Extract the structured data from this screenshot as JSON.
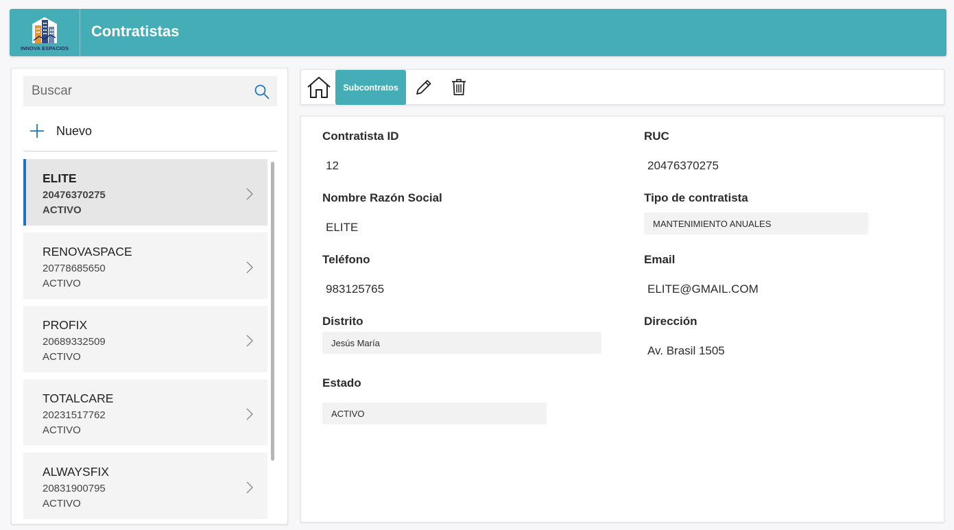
{
  "header": {
    "logo_text": "INNOVA ESPACIOS",
    "title": "Contratistas",
    "color": "#45adb6"
  },
  "search": {
    "placeholder": "Buscar"
  },
  "new_button": {
    "label": "Nuevo"
  },
  "list": [
    {
      "name": "ELITE",
      "ruc": "20476370275",
      "state": "ACTIVO",
      "selected": true
    },
    {
      "name": "RENOVASPACE",
      "ruc": "20778685650",
      "state": "ACTIVO"
    },
    {
      "name": "PROFIX",
      "ruc": "20689332509",
      "state": "ACTIVO"
    },
    {
      "name": "TOTALCARE",
      "ruc": "20231517762",
      "state": "ACTIVO"
    },
    {
      "name": "ALWAYSFIX",
      "ruc": "20831900795",
      "state": "ACTIVO"
    }
  ],
  "toolbar": {
    "subcontratos_label": "Subcontratos",
    "icons": [
      "home-icon",
      "pencil-icon",
      "trash-icon"
    ]
  },
  "form": {
    "contratista_id": {
      "label": "Contratista ID",
      "value": "12"
    },
    "ruc": {
      "label": "RUC",
      "value": "20476370275"
    },
    "nombre": {
      "label": "Nombre Razón Social",
      "value": "ELITE"
    },
    "tipo": {
      "label": "Tipo de contratista",
      "value": "MANTENIMIENTO ANUALES"
    },
    "telefono": {
      "label": "Teléfono",
      "value": "983125765"
    },
    "email": {
      "label": "Email",
      "value": "ELITE@GMAIL.COM"
    },
    "distrito": {
      "label": "Distrito",
      "value": "Jesús María"
    },
    "direccion": {
      "label": "Dirección",
      "value": "Av. Brasil 1505"
    },
    "estado": {
      "label": "Estado",
      "value": "ACTIVO"
    }
  },
  "colors": {
    "accent": "#45adb6",
    "selection_bar": "#1976c2",
    "search_icon": "#1976c2"
  }
}
